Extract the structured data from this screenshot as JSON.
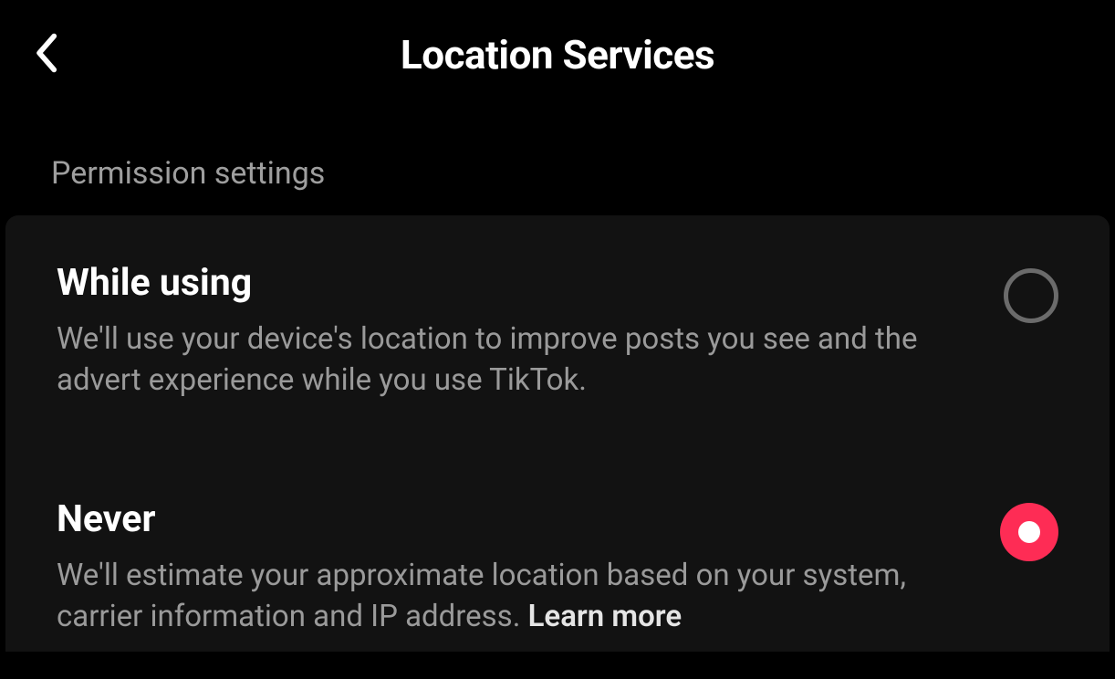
{
  "header": {
    "title": "Location Services"
  },
  "section": {
    "label": "Permission settings"
  },
  "options": [
    {
      "title": "While using",
      "description": "We'll use your device's location to improve posts you see and the advert experience while you use TikTok.",
      "selected": false
    },
    {
      "title": "Never",
      "description": "We'll estimate your approximate location based on your system, carrier information and IP address. ",
      "learn_more": "Learn more",
      "selected": true
    }
  ]
}
